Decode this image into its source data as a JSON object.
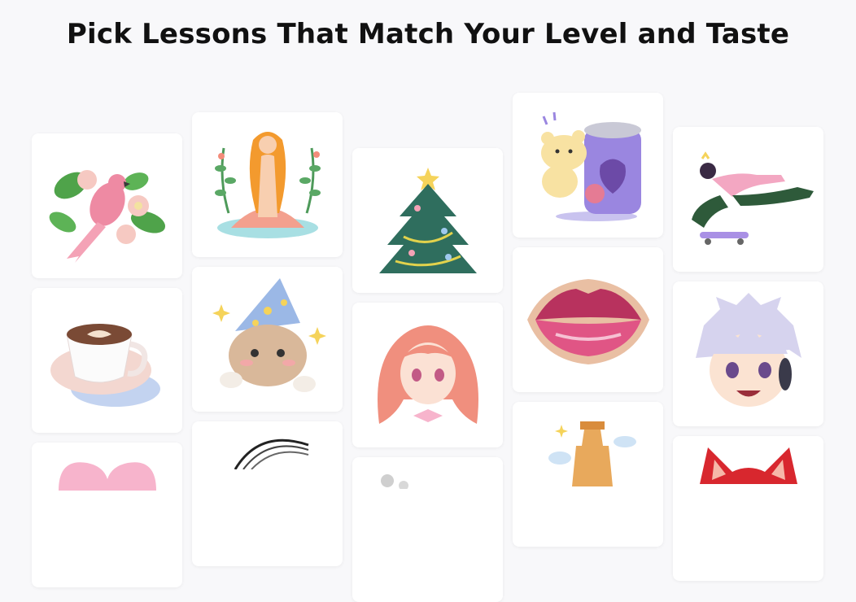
{
  "page": {
    "title": "Pick Lessons That Match Your Level and Taste"
  },
  "lessons": [
    {
      "name": "parrot-and-flowers"
    },
    {
      "name": "venus-on-shell"
    },
    {
      "name": "christmas-tree"
    },
    {
      "name": "bear-with-soda-can"
    },
    {
      "name": "skateboarder"
    },
    {
      "name": "latte-cup"
    },
    {
      "name": "cat-with-wizard-hat"
    },
    {
      "name": "anime-girl-pink-hair"
    },
    {
      "name": "lips"
    },
    {
      "name": "anime-boy-silver-hair"
    },
    {
      "name": "pink-heart"
    },
    {
      "name": "sketch-hair"
    },
    {
      "name": "gray-animal"
    },
    {
      "name": "tower-of-babel"
    },
    {
      "name": "red-fox"
    }
  ]
}
